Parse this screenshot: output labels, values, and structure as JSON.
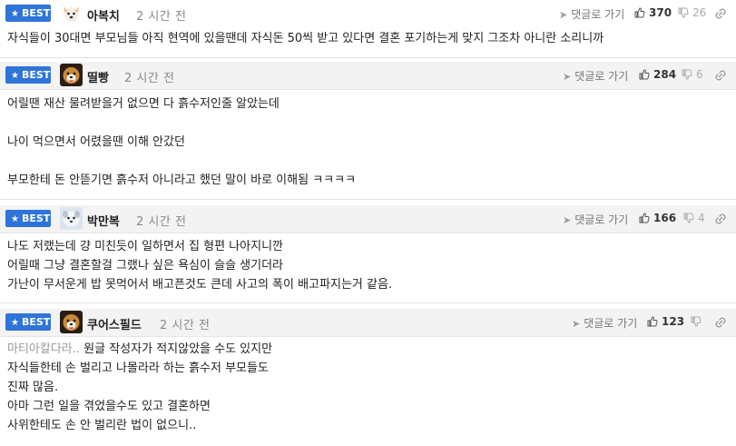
{
  "badge_label": "BEST",
  "reply_label": "댓글로 가기",
  "comments": [
    {
      "nickname": "아복치",
      "time": "2 시간 전",
      "likes": "370",
      "dislikes": "26",
      "lines": [
        "자식들이 30대면 부모님들 아직 현역에 있을땐데 자식돈 50씩 받고 있다면 결혼 포기하는게 맞지 그조차 아니란 소리니까"
      ]
    },
    {
      "nickname": "띨빵",
      "time": "2 시간 전",
      "likes": "284",
      "dislikes": "6",
      "lines": [
        "어릴땐 재산 물려받을거 없으면 다 흙수저인줄 알았는데",
        "",
        "나이 먹으면서 어렸을땐 이해 안갔던",
        "",
        "부모한테 돈 안뜯기면 흙수저 아니라고 했던 말이 바로 이해됨 ㅋㅋㅋㅋ"
      ]
    },
    {
      "nickname": "박만복",
      "time": "2 시간 전",
      "likes": "166",
      "dislikes": "4",
      "lines": [
        "나도 저랬는데 걍 미친듯이 일하면서 집 형편 나아지니깐",
        "어릴때 그냥 결혼할걸 그랬나 싶은 욕심이 슬슬 생기더라",
        "가난이 무서운게 밥 못먹어서 배고픈것도 큰데 사고의 폭이 배고파지는거 같음."
      ]
    },
    {
      "nickname": "쿠어스필드",
      "time": "2 시간 전",
      "likes": "123",
      "dislikes": "",
      "quote_to": "마티아칼다라..",
      "lines": [
        "원글 작성자가 적지않았을 수도 있지만",
        "자식들한테 손 벌리고 나몰라라 하는 흙수저 부모들도",
        "진짜 많음.",
        "아마 그런 일을 겪었을수도 있고 결혼하면",
        "사위한테도 손 안 벌리란 법이 없으니.."
      ]
    }
  ]
}
